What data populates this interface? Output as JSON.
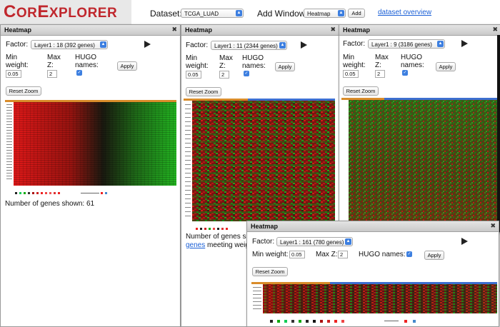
{
  "app": {
    "logo_text_co": "C",
    "logo_text_or": "OR",
    "logo_text_e": "E",
    "logo_text_xplorer": "XPLORER"
  },
  "toolbar": {
    "dataset_label": "Dataset:",
    "dataset_value": "TCGA_LUAD",
    "add_window_label": "Add Window:",
    "add_window_value": "Heatmap",
    "add_button": "Add",
    "overview_link": "dataset overview"
  },
  "windows": [
    {
      "title": "Heatmap",
      "close": "✖",
      "factor_label": "Factor:",
      "factor_value": "Layer1 : 18 (392 genes)",
      "min_weight_label": "Min weight:",
      "min_weight_value": "0.05",
      "max_z_label": "Max Z:",
      "max_z_value": "2",
      "hugo_label": "HUGO names:",
      "apply": "Apply",
      "reset_zoom": "Reset Zoom",
      "genes_shown": "Number of genes shown: 61"
    },
    {
      "title": "Heatmap",
      "close": "✖",
      "factor_label": "Factor:",
      "factor_value": "Layer1 : 11 (2344 genes)",
      "min_weight_label": "Min weight:",
      "min_weight_value": "0.05",
      "max_z_label": "Max Z:",
      "max_z_value": "2",
      "hugo_label": "HUGO names:",
      "apply": "Apply",
      "reset_zoom": "Reset Zoom",
      "genes_shown": "Number of genes sh",
      "genes_link": "genes",
      "genes_suffix": " meeting weig"
    },
    {
      "title": "Heatmap",
      "close": "✖",
      "factor_label": "Factor:",
      "factor_value": "Layer1 : 9 (3186 genes)",
      "min_weight_label": "Min weight:",
      "min_weight_value": "0.05",
      "max_z_label": "Max Z:",
      "max_z_value": "2",
      "hugo_label": "HUGO names:",
      "apply": "Apply",
      "reset_zoom": "Reset Zoom"
    },
    {
      "title": "Heatmap",
      "close": "✖",
      "factor_label": "Factor:",
      "factor_value": "Layer1 : 161 (780 genes)",
      "min_weight_label": "Min weight:",
      "min_weight_value": "0.05",
      "max_z_label": "Max Z:",
      "max_z_value": "2",
      "hugo_label": "HUGO names:",
      "apply": "Apply",
      "reset_zoom": "Reset Zoom"
    }
  ],
  "colors": {
    "accent": "#c0272d",
    "link": "#1a5fd6",
    "select_arrow": "#3d7fe0",
    "heat_red": "#e01818",
    "heat_green": "#18b018"
  }
}
